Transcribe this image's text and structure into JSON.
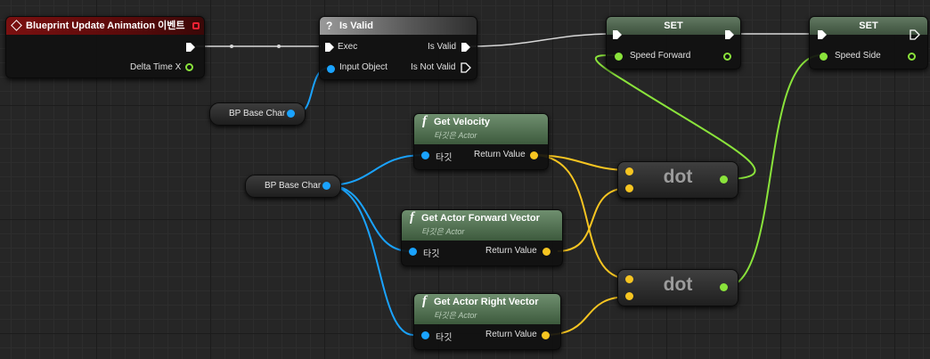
{
  "event_node": {
    "title": "Blueprint Update Animation 이벤트",
    "delta_time": "Delta Time X"
  },
  "is_valid_node": {
    "title": "Is Valid",
    "exec": "Exec",
    "input_object": "Input Object",
    "is_valid": "Is Valid",
    "is_not_valid": "Is Not Valid"
  },
  "var_node_1": {
    "label": "BP Base Char"
  },
  "var_node_2": {
    "label": "BP Base Char"
  },
  "get_velocity": {
    "title": "Get Velocity",
    "subtitle": "타깃은 Actor",
    "target": "타깃",
    "return_value": "Return Value"
  },
  "get_forward": {
    "title": "Get Actor Forward Vector",
    "subtitle": "타깃은 Actor",
    "target": "타깃",
    "return_value": "Return Value"
  },
  "get_right": {
    "title": "Get Actor Right Vector",
    "subtitle": "타깃은 Actor",
    "target": "타깃",
    "return_value": "Return Value"
  },
  "dot_1": {
    "label": "dot"
  },
  "dot_2": {
    "label": "dot"
  },
  "set_1": {
    "title": "SET",
    "var": "Speed Forward"
  },
  "set_2": {
    "title": "SET",
    "var": "Speed Side"
  },
  "colors": {
    "exec": "#ffffff",
    "object": "#1aa3ff",
    "vector": "#f7c521",
    "float": "#8ae33b"
  }
}
